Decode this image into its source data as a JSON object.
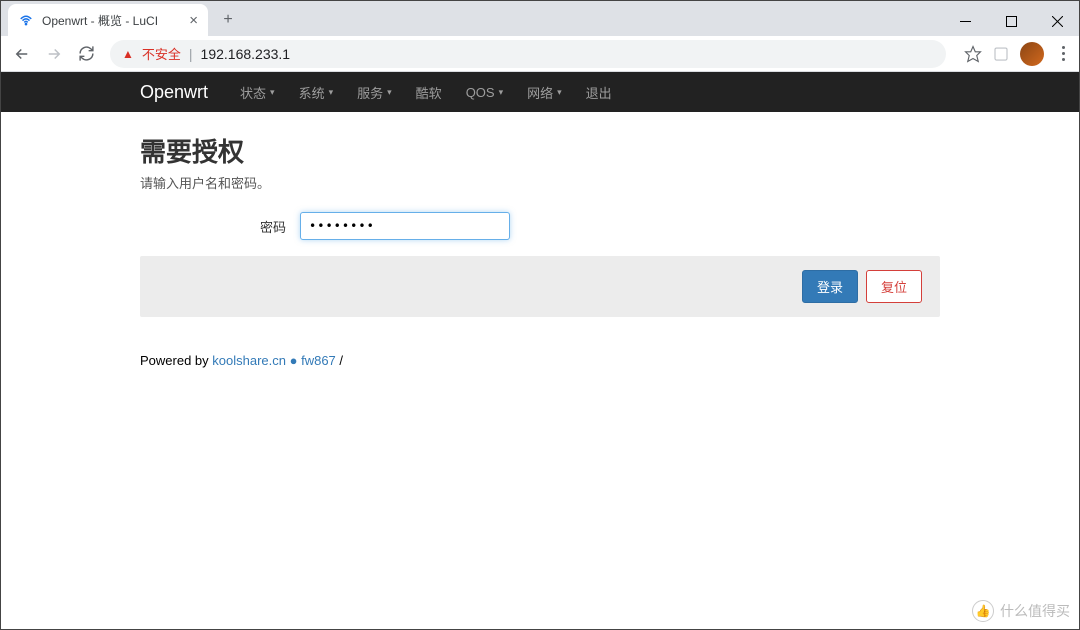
{
  "browser": {
    "tab_title": "Openwrt - 概览 - LuCI",
    "insecure_label": "不安全",
    "url": "192.168.233.1"
  },
  "navbar": {
    "brand": "Openwrt",
    "items": [
      {
        "label": "状态",
        "dropdown": true
      },
      {
        "label": "系统",
        "dropdown": true
      },
      {
        "label": "服务",
        "dropdown": true
      },
      {
        "label": "酷软",
        "dropdown": false
      },
      {
        "label": "QOS",
        "dropdown": true
      },
      {
        "label": "网络",
        "dropdown": true
      },
      {
        "label": "退出",
        "dropdown": false
      }
    ]
  },
  "page": {
    "title": "需要授权",
    "subtitle": "请输入用户名和密码。",
    "password_label": "密码",
    "password_value": "••••••••",
    "login_label": "登录",
    "reset_label": "复位"
  },
  "footer": {
    "powered": "Powered by",
    "link1": "koolshare.cn",
    "link2": "fw867",
    "tail": "/"
  },
  "watermark": {
    "text": "什么值得买"
  }
}
